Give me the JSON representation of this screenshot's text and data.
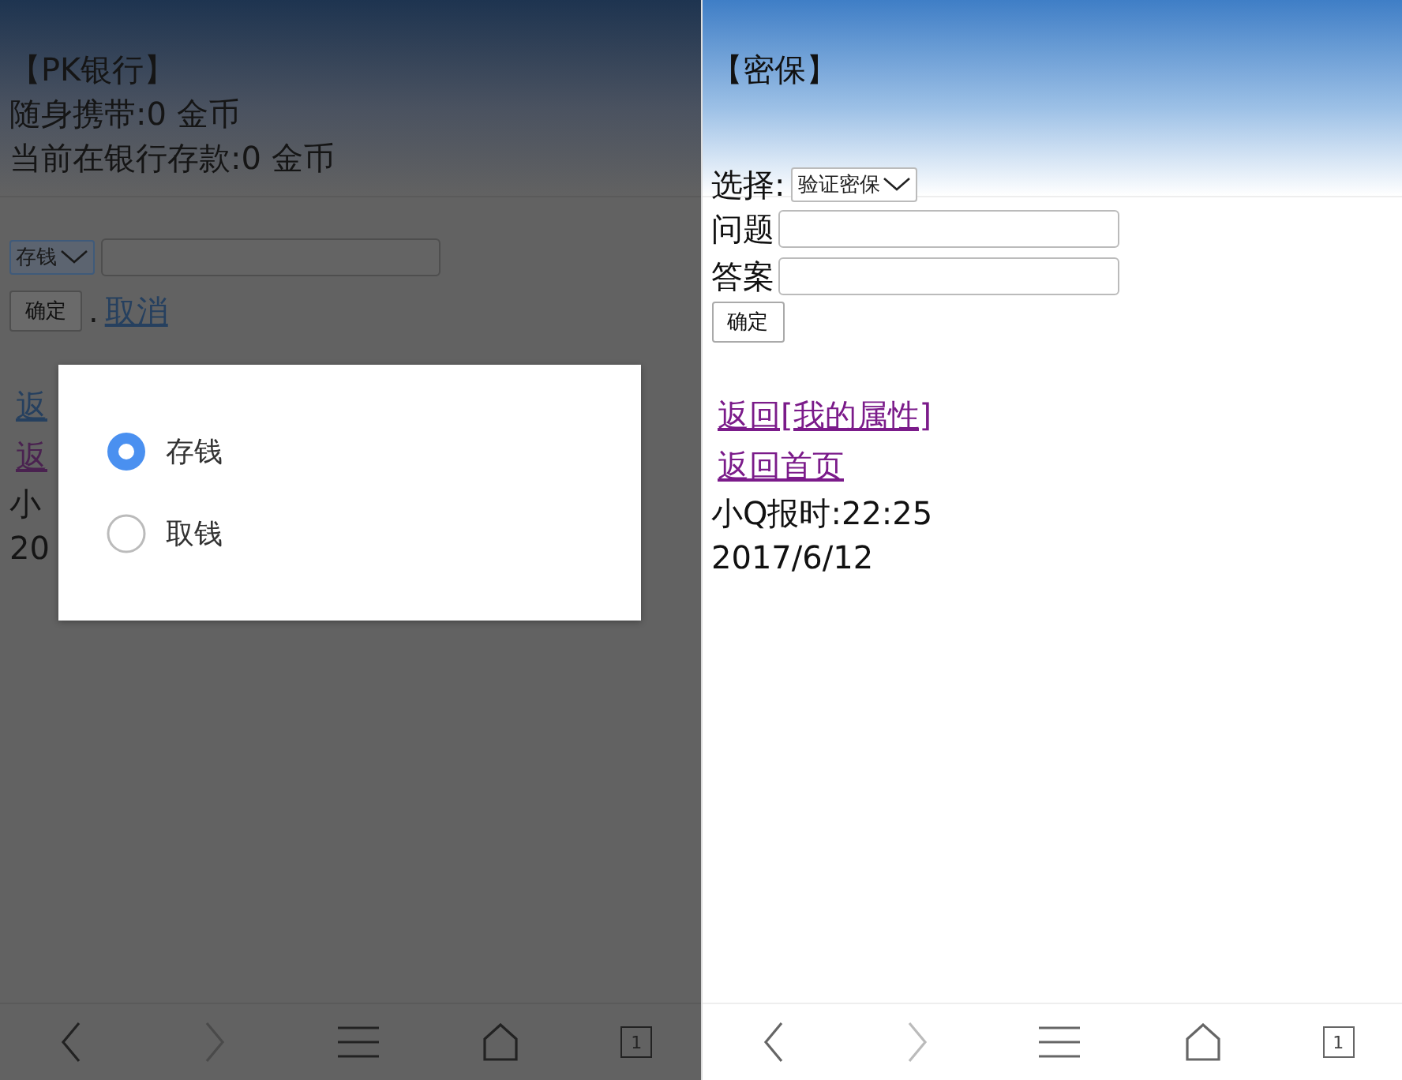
{
  "screens": [
    {
      "dimmed": true,
      "header": {
        "title": "【PK银行】",
        "lines": [
          "随身携带:0 金币",
          "当前在银行存款:0 金币"
        ]
      },
      "form": {
        "select": "存钱",
        "submit": "确定",
        "separator": ".",
        "cancel": "取消"
      },
      "links": [
        {
          "text": "返",
          "visited": false
        },
        {
          "text": "返",
          "visited": true
        }
      ],
      "footer": [
        "小",
        "20"
      ],
      "dialog": {
        "options": [
          {
            "label": "存钱",
            "selected": true
          },
          {
            "label": "取钱",
            "selected": false
          }
        ]
      },
      "nav": [
        {
          "kind": "back",
          "disabled": false
        },
        {
          "kind": "forward",
          "disabled": true
        },
        {
          "kind": "menu",
          "disabled": false
        },
        {
          "kind": "home",
          "disabled": false
        },
        {
          "kind": "tabs",
          "count": "1",
          "disabled": false
        }
      ]
    },
    {
      "dimmed": false,
      "header": {
        "title": "【密保】"
      },
      "secform": {
        "select_label": "选择:",
        "select": "验证密保",
        "fields": [
          {
            "label": "问题"
          },
          {
            "label": "答案"
          }
        ],
        "submit": "确定"
      },
      "links": [
        {
          "text": "返回[我的属性]",
          "visited": true
        },
        {
          "text": "返回首页",
          "visited": true
        }
      ],
      "footer": [
        "小Q报时:22:25",
        "2017/6/12"
      ],
      "nav": [
        {
          "kind": "back",
          "disabled": false
        },
        {
          "kind": "forward",
          "disabled": true
        },
        {
          "kind": "menu",
          "disabled": false
        },
        {
          "kind": "home",
          "disabled": false
        },
        {
          "kind": "tabs",
          "count": "1",
          "disabled": false
        }
      ]
    }
  ]
}
